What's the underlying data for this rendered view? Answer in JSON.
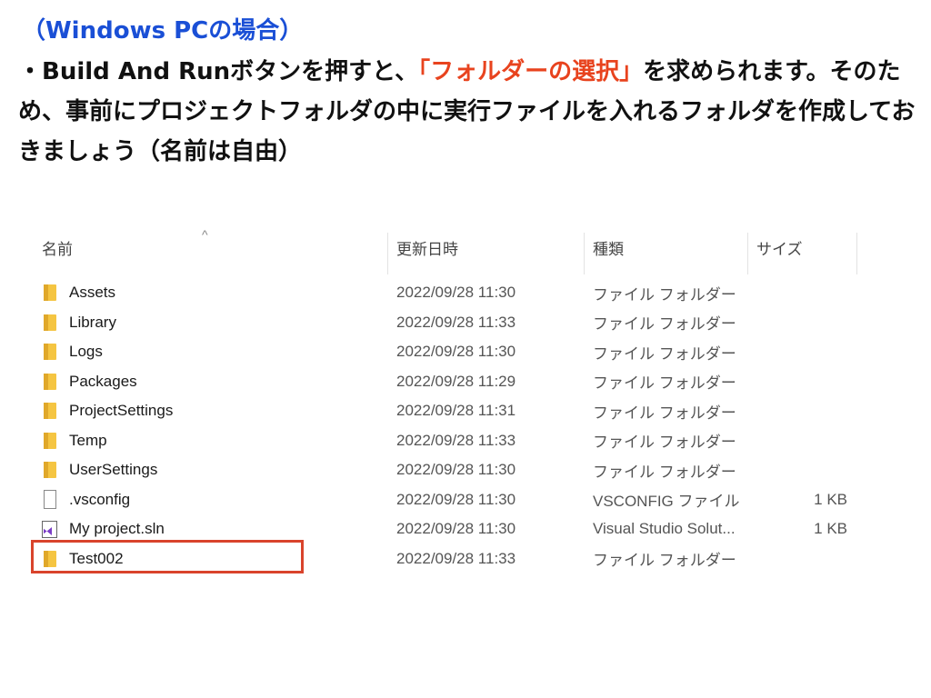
{
  "heading": "（Windows PCの場合）",
  "instructions": {
    "part1": "・Build And Runボタンを押すと、",
    "highlight": "「フォルダーの選択」",
    "part2": "を求められます。そのため、事前にプロジェクトフォルダの中に実行ファイルを入れるフォルダを作成しておきましょう（名前は自由）"
  },
  "colors": {
    "heading": "#1a4fd6",
    "highlight": "#e8431e",
    "selection_box": "#d9442c"
  },
  "explorer": {
    "columns": {
      "name": "名前",
      "date": "更新日時",
      "type": "種類",
      "size": "サイズ"
    },
    "sort_indicator": "^",
    "rows": [
      {
        "icon": "folder-icon",
        "name": "Assets",
        "date": "2022/09/28 11:30",
        "type": "ファイル フォルダー",
        "size": ""
      },
      {
        "icon": "folder-icon",
        "name": "Library",
        "date": "2022/09/28 11:33",
        "type": "ファイル フォルダー",
        "size": ""
      },
      {
        "icon": "folder-icon",
        "name": "Logs",
        "date": "2022/09/28 11:30",
        "type": "ファイル フォルダー",
        "size": ""
      },
      {
        "icon": "folder-icon",
        "name": "Packages",
        "date": "2022/09/28 11:29",
        "type": "ファイル フォルダー",
        "size": ""
      },
      {
        "icon": "folder-icon",
        "name": "ProjectSettings",
        "date": "2022/09/28 11:31",
        "type": "ファイル フォルダー",
        "size": ""
      },
      {
        "icon": "folder-icon",
        "name": "Temp",
        "date": "2022/09/28 11:33",
        "type": "ファイル フォルダー",
        "size": ""
      },
      {
        "icon": "folder-icon",
        "name": "UserSettings",
        "date": "2022/09/28 11:30",
        "type": "ファイル フォルダー",
        "size": ""
      },
      {
        "icon": "file-icon",
        "name": ".vsconfig",
        "date": "2022/09/28 11:30",
        "type": "VSCONFIG ファイル",
        "size": "1 KB"
      },
      {
        "icon": "visual-studio-solution-icon",
        "name": "My project.sln",
        "date": "2022/09/28 11:30",
        "type": "Visual Studio Solut...",
        "size": "1 KB"
      },
      {
        "icon": "folder-icon",
        "name": "Test002",
        "date": "2022/09/28 11:33",
        "type": "ファイル フォルダー",
        "size": ""
      }
    ]
  }
}
